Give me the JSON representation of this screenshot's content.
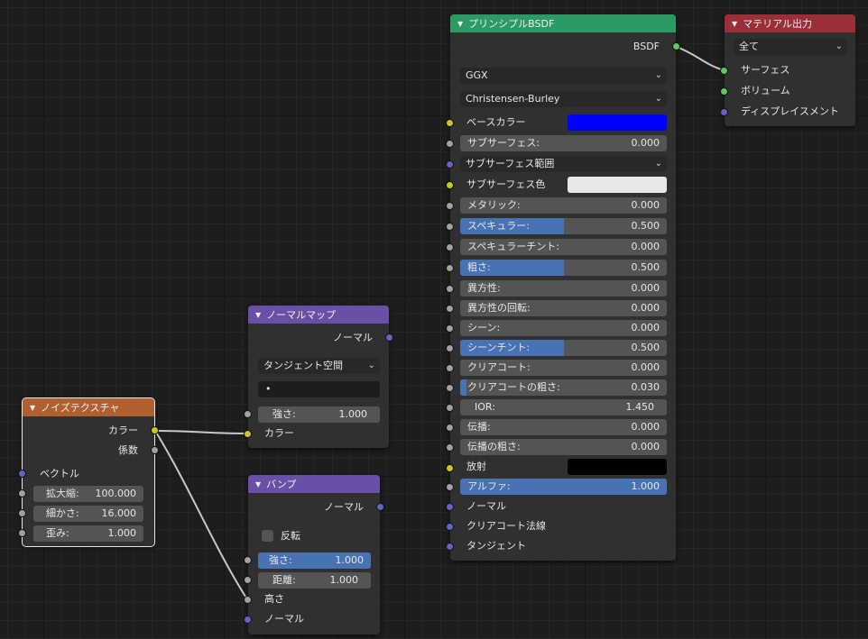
{
  "noise": {
    "title": "ノイズテクスチャ",
    "out_color": "カラー",
    "out_fac": "係数",
    "in_vector": "ベクトル",
    "scale_label": "拡大縮:",
    "scale_value": "100.000",
    "detail_label": "細かさ:",
    "detail_value": "16.000",
    "distortion_label": "歪み:",
    "distortion_value": "1.000"
  },
  "normal_map": {
    "title": "ノーマルマップ",
    "out_normal": "ノーマル",
    "space": "タンジェント空間",
    "uv_value": "•",
    "strength_label": "強さ:",
    "strength_value": "1.000",
    "in_color": "カラー"
  },
  "bump": {
    "title": "バンプ",
    "out_normal": "ノーマル",
    "invert_label": "反転",
    "strength_label": "強さ:",
    "strength_value": "1.000",
    "strength_fraction": 1.0,
    "distance_label": "距離:",
    "distance_value": "1.000",
    "in_height": "高さ",
    "in_normal": "ノーマル"
  },
  "bsdf": {
    "title": "プリンシプルBSDF",
    "out_bsdf": "BSDF",
    "distribution": "GGX",
    "subsurface_method": "Christensen-Burley",
    "base_color_label": "ベースカラー",
    "base_color": "#0000ff",
    "subsurface_label": "サブサーフェス:",
    "subsurface_value": "0.000",
    "subsurface_radius_label": "サブサーフェス範囲",
    "subsurface_color_label": "サブサーフェス色",
    "subsurface_color": "#e8e8e8",
    "metallic_label": "メタリック:",
    "metallic_value": "0.000",
    "specular_label": "スペキュラー:",
    "specular_value": "0.500",
    "specular_fraction": 0.5,
    "specular_tint_label": "スペキュラーチント:",
    "specular_tint_value": "0.000",
    "roughness_label": "粗さ:",
    "roughness_value": "0.500",
    "roughness_fraction": 0.5,
    "anisotropic_label": "異方性:",
    "anisotropic_value": "0.000",
    "anisotropic_rotation_label": "異方性の回転:",
    "anisotropic_rotation_value": "0.000",
    "sheen_label": "シーン:",
    "sheen_value": "0.000",
    "sheen_tint_label": "シーンチント:",
    "sheen_tint_value": "0.500",
    "sheen_tint_fraction": 0.5,
    "clearcoat_label": "クリアコート:",
    "clearcoat_value": "0.000",
    "clearcoat_roughness_label": "クリアコートの粗さ:",
    "clearcoat_roughness_value": "0.030",
    "clearcoat_roughness_fraction": 0.03,
    "ior_label": "IOR:",
    "ior_value": "1.450",
    "transmission_label": "伝播:",
    "transmission_value": "0.000",
    "transmission_roughness_label": "伝播の粗さ:",
    "transmission_roughness_value": "0.000",
    "emission_label": "放射",
    "emission_color": "#000000",
    "alpha_label": "アルファ:",
    "alpha_value": "1.000",
    "alpha_fraction": 1.0,
    "normal_label": "ノーマル",
    "clearcoat_normal_label": "クリアコート法線",
    "tangent_label": "タンジェント"
  },
  "output": {
    "title": "マテリアル出力",
    "target": "全て",
    "in_surface": "サーフェス",
    "in_volume": "ボリューム",
    "in_displacement": "ディスプレイスメント"
  },
  "colors": {
    "header_texture": "#b06030",
    "header_vector": "#6a4fa8",
    "header_shader": "#2d9a66",
    "header_output": "#9a2f3a",
    "accent_field": "#4772b3"
  },
  "icons": {
    "collapse": "triangle-down-icon",
    "dropdown": "chevron-down-icon"
  }
}
